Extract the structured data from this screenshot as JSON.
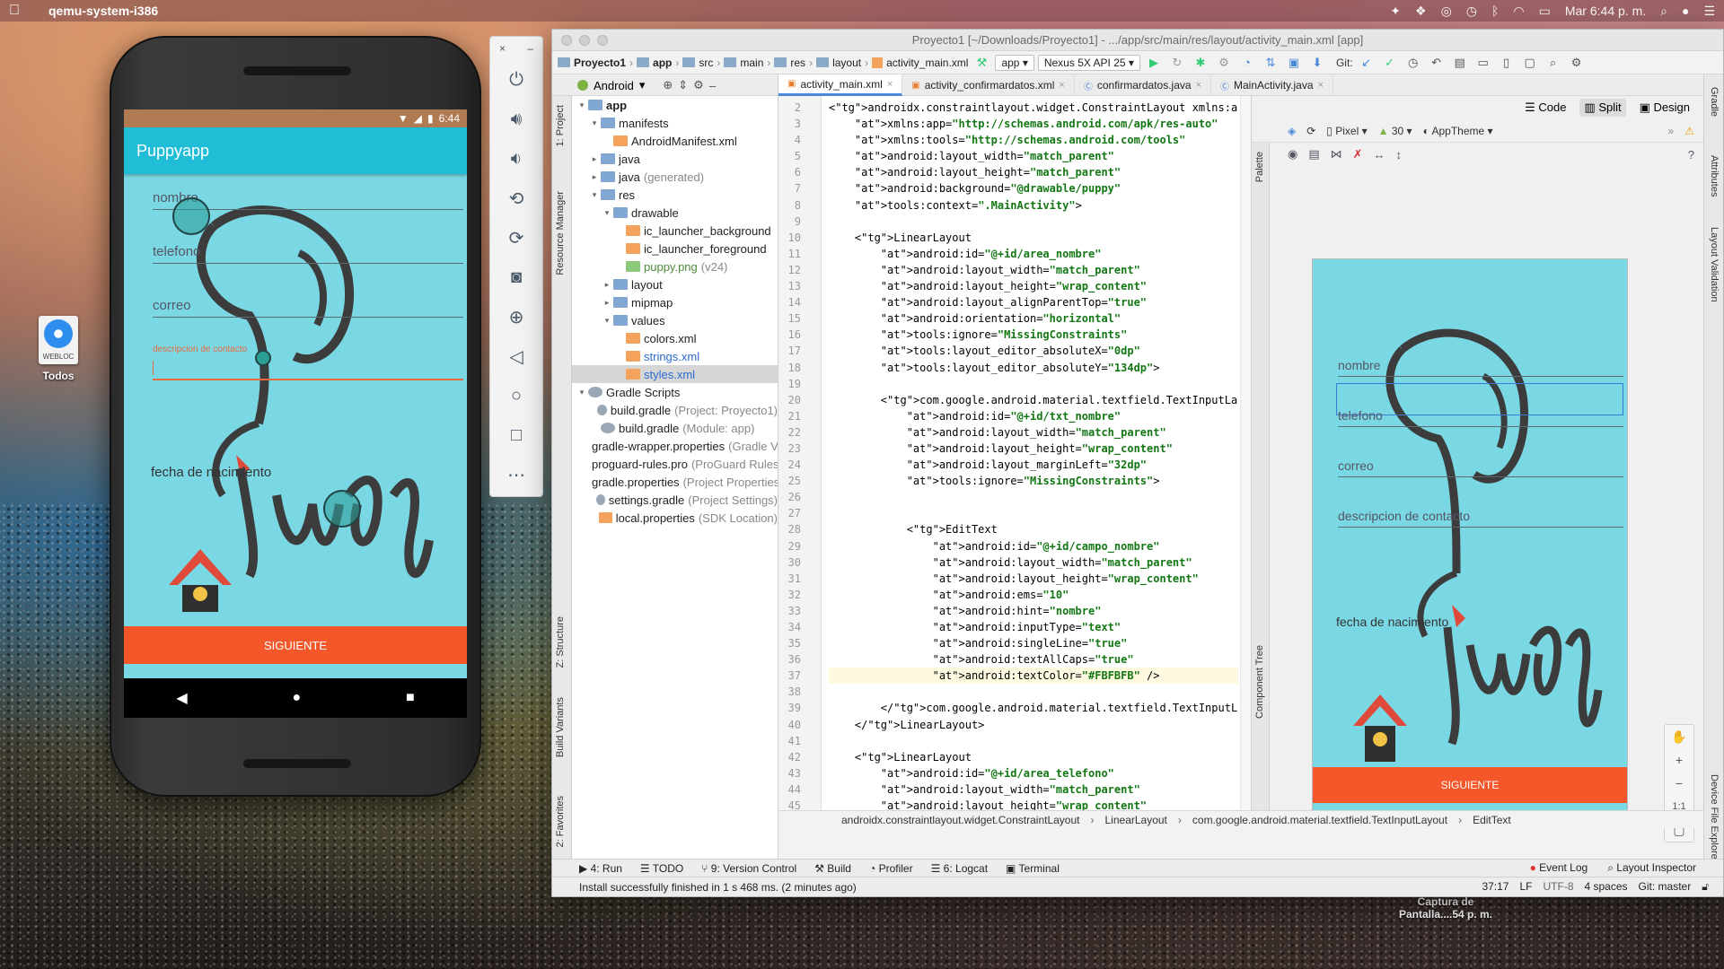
{
  "menubar": {
    "app_name": "qemu-system-i386",
    "datetime": "Mar 6:44 p. m."
  },
  "desktop": {
    "icon_tag": "WEBLOC",
    "icon_label": "Todos",
    "screenshot_label_1": "Captura de",
    "screenshot_label_2": "Pantalla....54 p. m."
  },
  "phone": {
    "time": "6:44",
    "app_title": "Puppyapp",
    "fields": [
      "nombre",
      "telefono",
      "correo"
    ],
    "active_field_hint": "descripcion de contacto",
    "fecha_label": "fecha de nacimiento",
    "button": "SIGUIENTE"
  },
  "studio": {
    "title": "Proyecto1 [~/Downloads/Proyecto1] - .../app/src/main/res/layout/activity_main.xml [app]",
    "nav_crumbs": [
      "Proyecto1",
      "app",
      "src",
      "main",
      "res",
      "layout",
      "activity_main.xml"
    ],
    "run_config": "app",
    "device": "Nexus 5X API 25",
    "git_label": "Git:",
    "project_view": "Android",
    "editor_tabs": [
      "activity_main.xml",
      "activity_confirmardatos.xml",
      "confirmardatos.java",
      "MainActivity.java"
    ],
    "project_tree": [
      {
        "label": "app",
        "level": 0,
        "icon": "fold",
        "arrow": "▾",
        "bold": true
      },
      {
        "label": "manifests",
        "level": 1,
        "icon": "fold",
        "arrow": "▾"
      },
      {
        "label": "AndroidManifest.xml",
        "level": 2,
        "icon": "xml"
      },
      {
        "label": "java",
        "level": 1,
        "icon": "fold",
        "arrow": "▸"
      },
      {
        "label": "java",
        "meta": "(generated)",
        "level": 1,
        "icon": "fold",
        "arrow": "▸"
      },
      {
        "label": "res",
        "level": 1,
        "icon": "fold",
        "arrow": "▾"
      },
      {
        "label": "drawable",
        "level": 2,
        "icon": "fold",
        "arrow": "▾"
      },
      {
        "label": "ic_launcher_background",
        "level": 3,
        "icon": "xml"
      },
      {
        "label": "ic_launcher_foreground",
        "level": 3,
        "icon": "xml"
      },
      {
        "label": "puppy.png",
        "meta": "(v24)",
        "level": 3,
        "icon": "png",
        "cls": "green"
      },
      {
        "label": "layout",
        "level": 2,
        "icon": "fold",
        "arrow": "▸"
      },
      {
        "label": "mipmap",
        "level": 2,
        "icon": "fold",
        "arrow": "▸"
      },
      {
        "label": "values",
        "level": 2,
        "icon": "fold",
        "arrow": "▾"
      },
      {
        "label": "colors.xml",
        "level": 3,
        "icon": "xml"
      },
      {
        "label": "strings.xml",
        "level": 3,
        "icon": "xml",
        "cls": "blue"
      },
      {
        "label": "styles.xml",
        "level": 3,
        "icon": "xml",
        "cls": "blue",
        "sel": true
      },
      {
        "label": "Gradle Scripts",
        "level": 0,
        "icon": "gradle",
        "arrow": "▾"
      },
      {
        "label": "build.gradle",
        "meta": "(Project: Proyecto1)",
        "level": 1,
        "icon": "gradle"
      },
      {
        "label": "build.gradle",
        "meta": "(Module: app)",
        "level": 1,
        "icon": "gradle"
      },
      {
        "label": "gradle-wrapper.properties",
        "meta": "(Gradle Version)",
        "level": 1,
        "icon": "xml"
      },
      {
        "label": "proguard-rules.pro",
        "meta": "(ProGuard Rules)",
        "level": 1,
        "icon": "xml"
      },
      {
        "label": "gradle.properties",
        "meta": "(Project Properties)",
        "level": 1,
        "icon": "xml"
      },
      {
        "label": "settings.gradle",
        "meta": "(Project Settings)",
        "level": 1,
        "icon": "gradle"
      },
      {
        "label": "local.properties",
        "meta": "(SDK Location)",
        "level": 1,
        "icon": "xml"
      }
    ],
    "code_lines": [
      {
        "n": 2,
        "t": "<androidx.constraintlayout.widget.ConstraintLayout xmlns:android"
      },
      {
        "n": 3,
        "t": "    xmlns:app=\"http://schemas.android.com/apk/res-auto\""
      },
      {
        "n": 4,
        "t": "    xmlns:tools=\"http://schemas.android.com/tools\""
      },
      {
        "n": 5,
        "t": "    android:layout_width=\"match_parent\""
      },
      {
        "n": 6,
        "t": "    android:layout_height=\"match_parent\""
      },
      {
        "n": 7,
        "t": "    android:background=\"@drawable/puppy\""
      },
      {
        "n": 8,
        "t": "    tools:context=\".MainActivity\">"
      },
      {
        "n": 9,
        "t": ""
      },
      {
        "n": 10,
        "t": "    <LinearLayout"
      },
      {
        "n": 11,
        "t": "        android:id=\"@+id/area_nombre\""
      },
      {
        "n": 12,
        "t": "        android:layout_width=\"match_parent\""
      },
      {
        "n": 13,
        "t": "        android:layout_height=\"wrap_content\""
      },
      {
        "n": 14,
        "t": "        android:layout_alignParentTop=\"true\""
      },
      {
        "n": 15,
        "t": "        android:orientation=\"horizontal\""
      },
      {
        "n": 16,
        "t": "        tools:ignore=\"MissingConstraints\""
      },
      {
        "n": 17,
        "t": "        tools:layout_editor_absoluteX=\"0dp\""
      },
      {
        "n": 18,
        "t": "        tools:layout_editor_absoluteY=\"134dp\">"
      },
      {
        "n": 19,
        "t": ""
      },
      {
        "n": 20,
        "t": "        <com.google.android.material.textfield.TextInputLayout"
      },
      {
        "n": 21,
        "t": "            android:id=\"@+id/txt_nombre\""
      },
      {
        "n": 22,
        "t": "            android:layout_width=\"match_parent\""
      },
      {
        "n": 23,
        "t": "            android:layout_height=\"wrap_content\""
      },
      {
        "n": 24,
        "t": "            android:layout_marginLeft=\"32dp\""
      },
      {
        "n": 25,
        "t": "            tools:ignore=\"MissingConstraints\">"
      },
      {
        "n": 26,
        "t": ""
      },
      {
        "n": 27,
        "t": ""
      },
      {
        "n": 28,
        "t": "            <EditText"
      },
      {
        "n": 29,
        "t": "                android:id=\"@+id/campo_nombre\""
      },
      {
        "n": 30,
        "t": "                android:layout_width=\"match_parent\""
      },
      {
        "n": 31,
        "t": "                android:layout_height=\"wrap_content\""
      },
      {
        "n": 32,
        "t": "                android:ems=\"10\""
      },
      {
        "n": 33,
        "t": "                android:hint=\"nombre\""
      },
      {
        "n": 34,
        "t": "                android:inputType=\"text\""
      },
      {
        "n": 35,
        "t": "                android:singleLine=\"true\""
      },
      {
        "n": 36,
        "t": "                android:textAllCaps=\"true\""
      },
      {
        "n": 37,
        "t": "                android:textColor=\"#FBFBFB\" />"
      },
      {
        "n": 38,
        "t": ""
      },
      {
        "n": 39,
        "t": "        </com.google.android.material.textfield.TextInputLayout>"
      },
      {
        "n": 40,
        "t": "    </LinearLayout>"
      },
      {
        "n": 41,
        "t": ""
      },
      {
        "n": 42,
        "t": "    <LinearLayout"
      },
      {
        "n": 43,
        "t": "        android:id=\"@+id/area_telefono\""
      },
      {
        "n": 44,
        "t": "        android:layout_width=\"match_parent\""
      },
      {
        "n": 45,
        "t": "        android:layout_height=\"wrap_content\""
      }
    ],
    "design_modes": [
      "Code",
      "Split",
      "Design"
    ],
    "design_tools": {
      "device": "Pixel",
      "api": "30",
      "theme": "AppTheme"
    },
    "preview": {
      "fields": [
        "nombre",
        "telefono",
        "correo",
        "descripcion de contacto"
      ],
      "fecha": "fecha de nacimiento",
      "button": "SIGUIENTE"
    },
    "breadcrumb": [
      "androidx.constraintlayout.widget.ConstraintLayout",
      "LinearLayout",
      "com.google.android.material.textfield.TextInputLayout",
      "EditText"
    ],
    "bottom_tools": [
      "4: Run",
      "TODO",
      "9: Version Control",
      "Build",
      "Profiler",
      "6: Logcat",
      "Terminal"
    ],
    "bottom_right_tools": [
      "Event Log",
      "Layout Inspector"
    ],
    "status_message": "Install successfully finished in 1 s 468 ms. (2 minutes ago)",
    "status_right": [
      "37:17",
      "LF",
      "UTF-8",
      "4 spaces",
      "Git: master"
    ],
    "left_strip_labels": [
      "1: Project",
      "Resource Manager",
      "Z: Structure",
      "Build Variants",
      "2: Favorites"
    ],
    "right_strip_labels": [
      "Gradle",
      "Attributes",
      "Layout Validation",
      "Device File Explorer"
    ],
    "design_side_labels": [
      "Palette",
      "Component Tree"
    ]
  },
  "colors": {
    "accent_teal": "#1fbdd6",
    "button_orange": "#f4572a",
    "phone_bg": "#7ad8e4"
  }
}
